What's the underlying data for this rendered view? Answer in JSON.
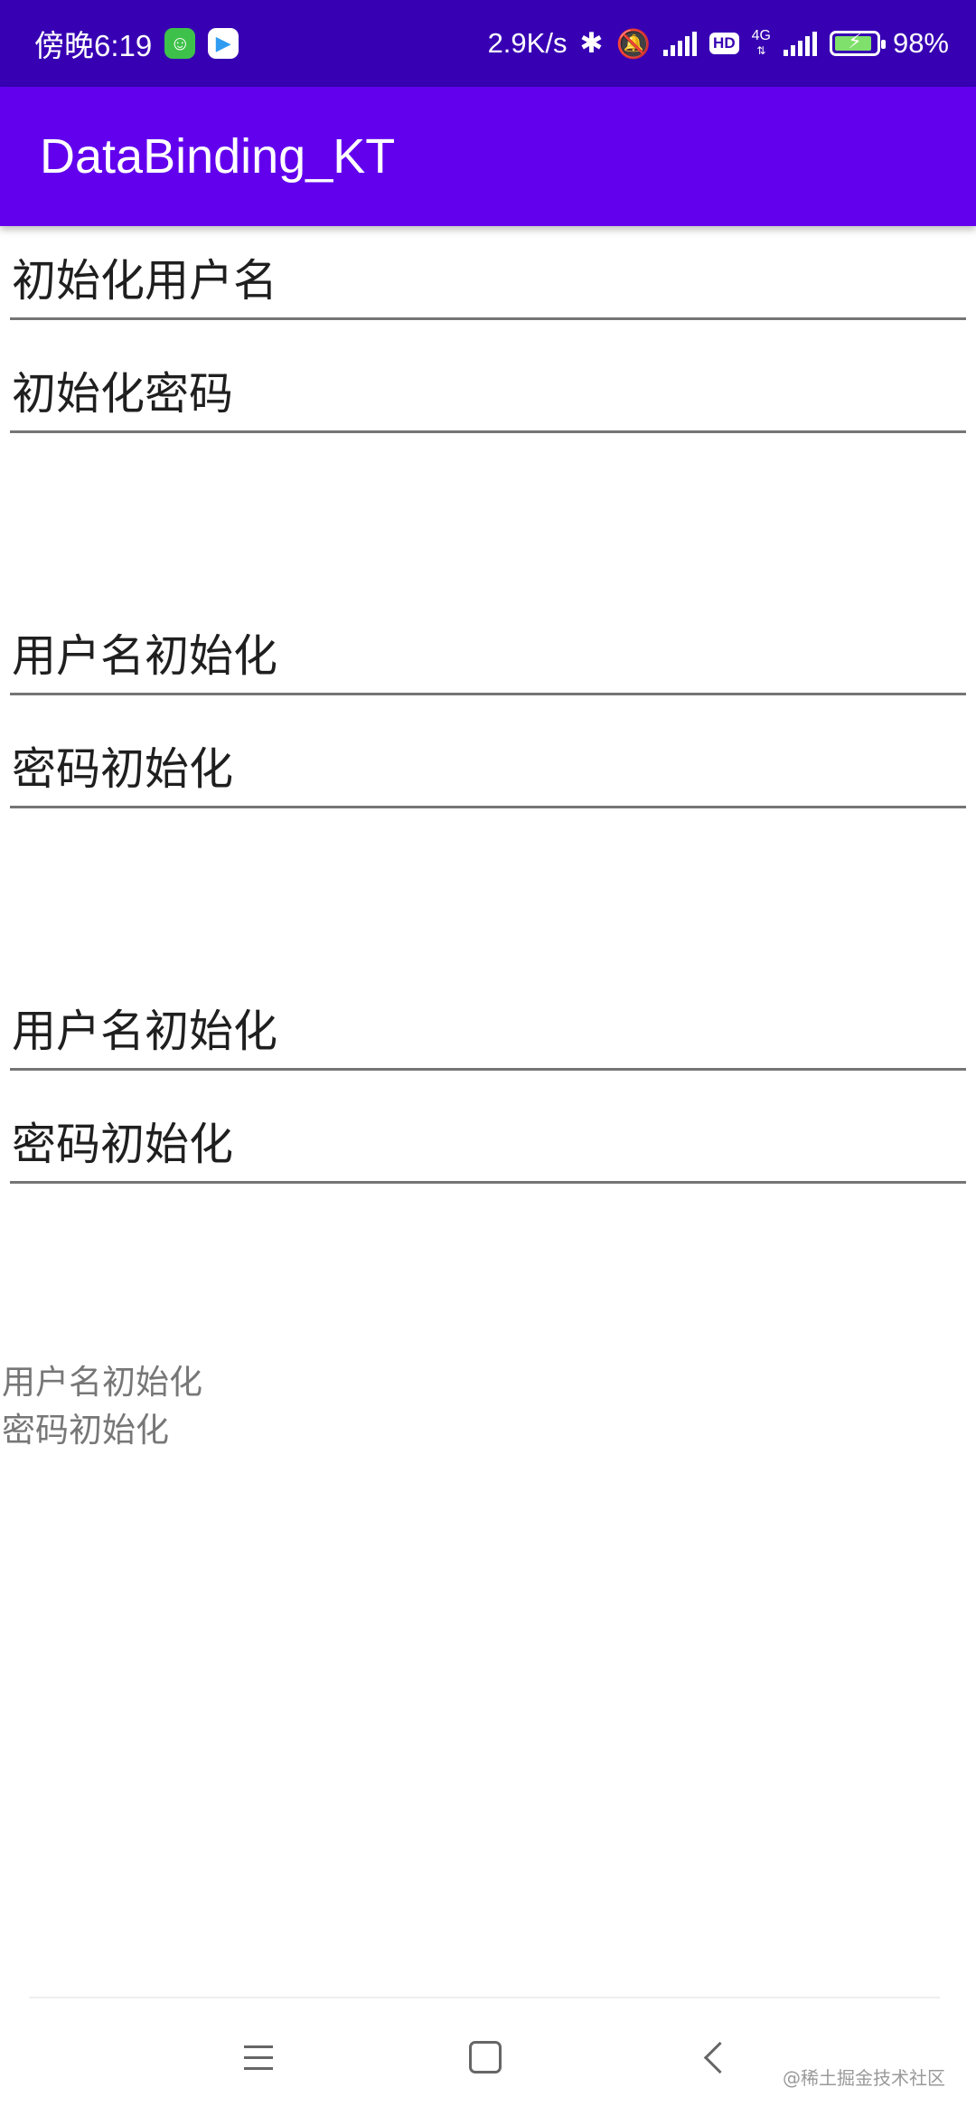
{
  "status_bar": {
    "time": "傍晚6:19",
    "net_speed": "2.9K/s",
    "network_type": "4G",
    "hd_badge": "HD",
    "battery_percent": "98%",
    "icons": [
      "wechat-app-icon",
      "video-app-icon",
      "bluetooth-icon",
      "mute-bell-icon",
      "signal-icon",
      "hd-icon",
      "4g-signal-icon",
      "battery-icon"
    ]
  },
  "app_bar": {
    "title": "DataBinding_KT"
  },
  "sections": [
    {
      "username": "初始化用户名",
      "password": "初始化密码"
    },
    {
      "username": "用户名初始化",
      "password": "密码初始化"
    },
    {
      "username": "用户名初始化",
      "password": "密码初始化"
    }
  ],
  "text_display": {
    "line1": "用户名初始化",
    "line2": "密码初始化"
  },
  "nav_bar": {
    "icons": [
      "menu-icon",
      "home-icon",
      "back-icon"
    ]
  },
  "watermark": "@稀土掘金技术社区",
  "colors": {
    "status_bar": "#3700B3",
    "app_bar": "#6200EE",
    "underline": "#757575"
  }
}
